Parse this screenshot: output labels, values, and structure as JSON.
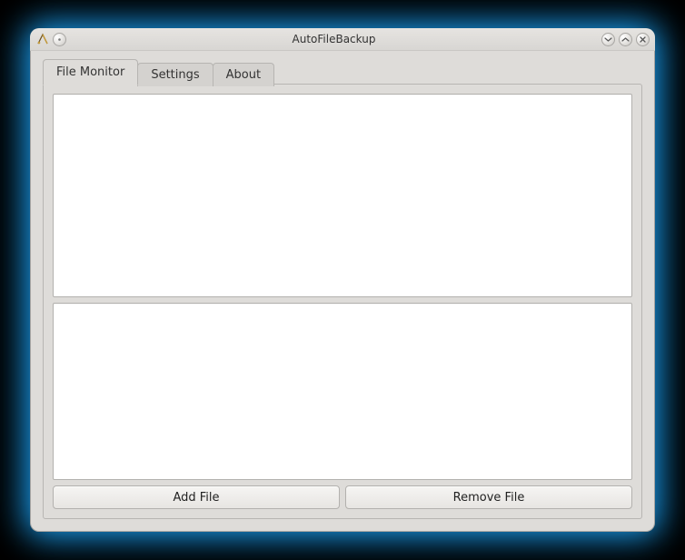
{
  "window": {
    "title": "AutoFileBackup"
  },
  "tabs": [
    {
      "label": "File Monitor",
      "active": true
    },
    {
      "label": "Settings",
      "active": false
    },
    {
      "label": "About",
      "active": false
    }
  ],
  "buttons": {
    "add_file": "Add File",
    "remove_file": "Remove File"
  }
}
